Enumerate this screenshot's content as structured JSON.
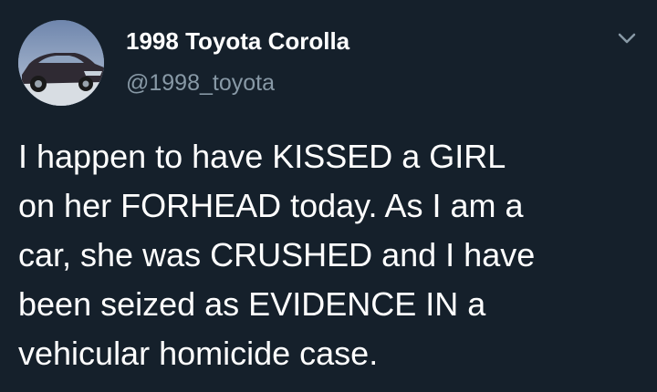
{
  "author": {
    "display_name": "1998 Toyota Corolla",
    "handle": "@1998_toyota",
    "avatar_icon": "car-photo-avatar"
  },
  "menu_icon": "chevron-down-icon",
  "tweet": {
    "lines": [
      "I happen to have KISSED a GIRL",
      "on her FORHEAD today. As I am a",
      "car, she was CRUSHED and I have",
      "been seized as EVIDENCE IN a",
      "vehicular homicide case."
    ]
  },
  "colors": {
    "background": "#15202b",
    "text": "#ffffff",
    "secondary_text": "#8899a6"
  }
}
